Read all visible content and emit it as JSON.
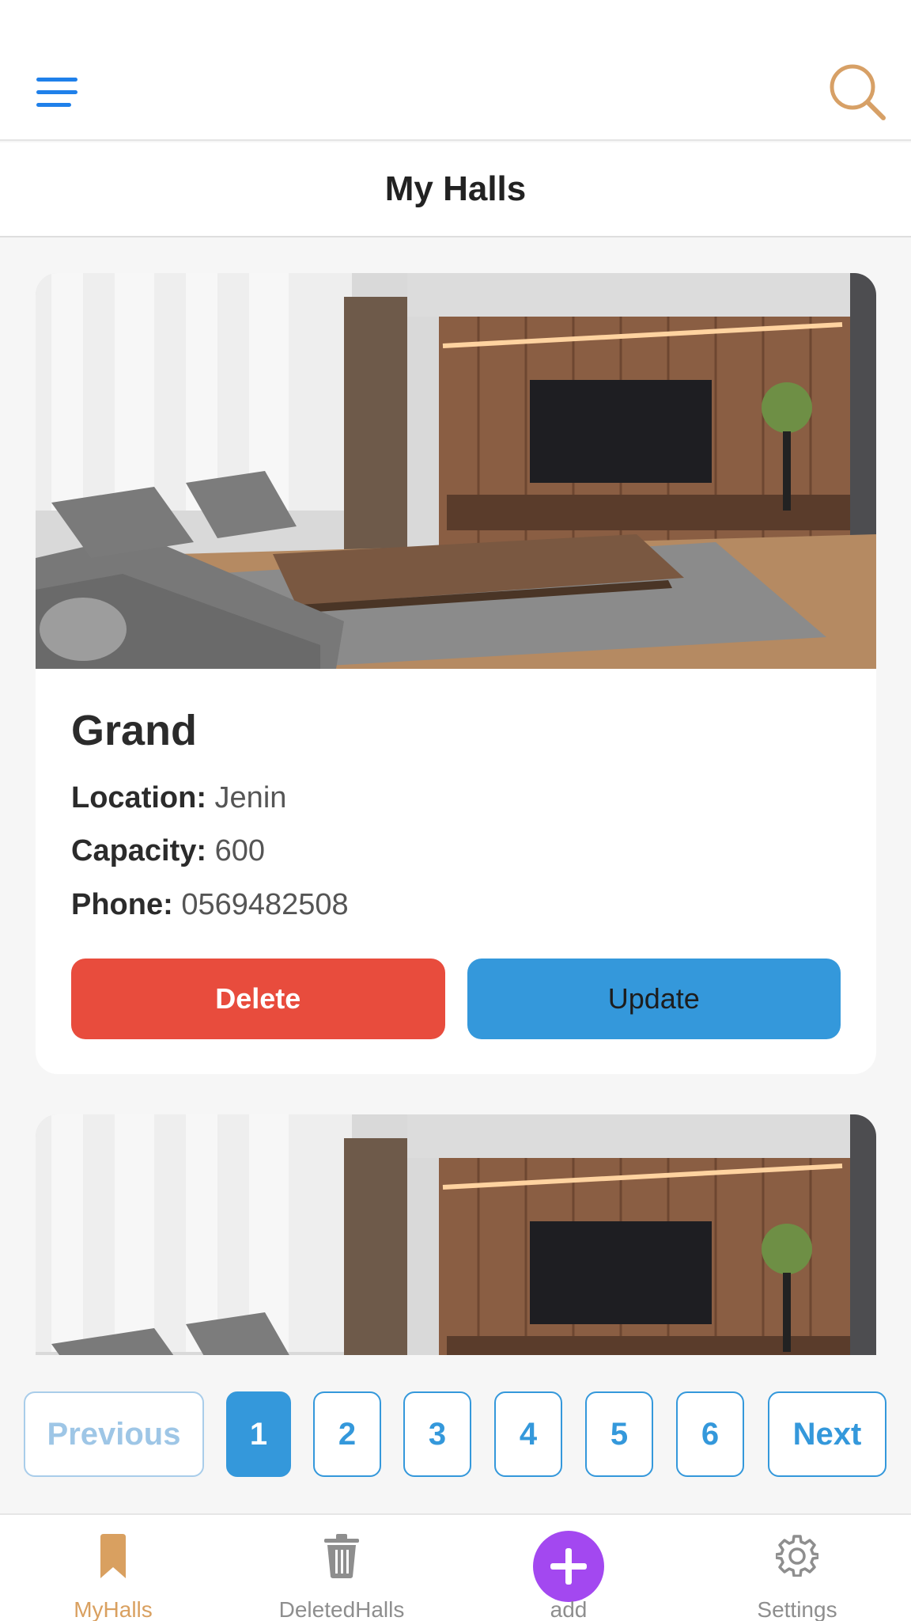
{
  "page": {
    "title": "My Halls"
  },
  "halls": [
    {
      "name": "Grand",
      "location_label": "Location:",
      "location": "Jenin",
      "capacity_label": "Capacity:",
      "capacity": "600",
      "phone_label": "Phone:",
      "phone": "0569482508",
      "delete_label": "Delete",
      "update_label": "Update",
      "image": "living-room-photo"
    },
    {
      "image": "living-room-photo"
    }
  ],
  "pagination": {
    "previous_label": "Previous",
    "next_label": "Next",
    "pages": [
      "1",
      "2",
      "3",
      "4",
      "5",
      "6"
    ],
    "current_page": "1"
  },
  "tabbar": {
    "items": [
      {
        "label": "MyHalls",
        "icon": "bookmark-icon",
        "active": true
      },
      {
        "label": "DeletedHalls",
        "icon": "trash-icon",
        "active": false
      },
      {
        "label": "add",
        "icon": "plus-icon",
        "active": false
      },
      {
        "label": "Settings",
        "icon": "gear-icon",
        "active": false
      }
    ]
  },
  "colors": {
    "accent_blue": "#3498db",
    "delete_red": "#e84c3d",
    "tab_active": "#d9a060",
    "add_purple": "#a348f0",
    "menu_blue": "#1f80ea"
  }
}
